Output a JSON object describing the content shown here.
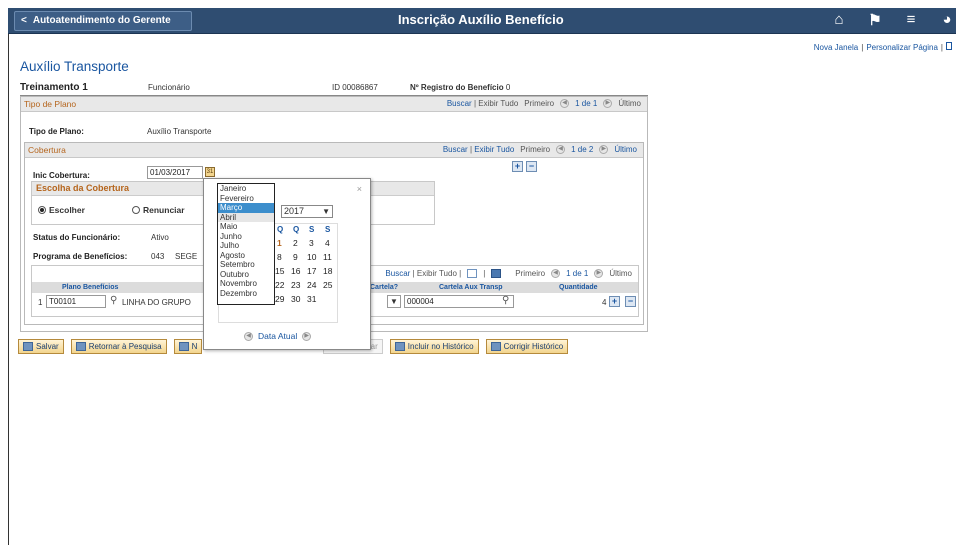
{
  "header": {
    "back_label": "Autoatendimento do Gerente",
    "page_title": "Inscrição Auxílio Benefício",
    "links": [
      "Nova Janela",
      "Personalizar Página"
    ]
  },
  "main": {
    "title": "Auxílio Transporte",
    "employee": {
      "name": "Treinamento 1",
      "role": "Funcionário",
      "id_label": "ID",
      "id_value": "00086867",
      "reg_label": "Nº Registro do Benefício",
      "reg_value": "0"
    },
    "tipo_plano": {
      "section_title": "Tipo de Plano",
      "nav": {
        "buscar": "Buscar",
        "exibir": "Exibir Tudo",
        "primeiro": "Primeiro",
        "count": "1 de 1",
        "ultimo": "Último"
      },
      "field_label": "Tipo de Plano:",
      "field_value": "Auxílio Transporte"
    },
    "cobertura": {
      "section_title": "Cobertura",
      "nav": {
        "buscar": "Buscar",
        "exibir": "Exibir Tudo",
        "primeiro": "Primeiro",
        "count": "1 de 2",
        "ultimo": "Último"
      },
      "inic_label": "Inic Cobertura:",
      "inic_value": "01/03/2017",
      "escolha_title": "Escolha da Cobertura",
      "escolher": "Escolher",
      "renunciar": "Renunciar",
      "status_label": "Status do Funcionário:",
      "status_value": "Ativo",
      "programa_label": "Programa de Benefícios:",
      "programa_code": "043",
      "programa_name": "SEGE"
    },
    "grid": {
      "nav": {
        "buscar": "Buscar",
        "exibir": "Exibir Tudo",
        "primeiro": "Primeiro",
        "count": "1 de 1",
        "ultimo": "Último"
      },
      "headers": {
        "plano": "Plano Benefícios",
        "cartela": "Cartela?",
        "cartela_aux": "Cartela Aux Transp",
        "quantidade": "Quantidade"
      },
      "row": {
        "num": "1",
        "plano": "T00101",
        "plano_desc": "LINHA DO GRUPO",
        "cartela_aux": "000004",
        "quantidade": "4"
      }
    }
  },
  "calendar": {
    "year": "2017",
    "months": [
      "Janeiro",
      "Fevereiro",
      "Março",
      "Abril",
      "Maio",
      "Junho",
      "Julho",
      "Agosto",
      "Setembro",
      "Outubro",
      "Novembro",
      "Dezembro"
    ],
    "weekday_heads": [
      "Q",
      "Q",
      "S",
      "S"
    ],
    "days": [
      [
        "1",
        "2",
        "3",
        "4"
      ],
      [
        "8",
        "9",
        "10",
        "11"
      ],
      [
        "15",
        "16",
        "17",
        "18"
      ],
      [
        "22",
        "23",
        "24",
        "25"
      ],
      [
        "29",
        "30",
        "31",
        ""
      ]
    ],
    "today_label": "Data Atual"
  },
  "toolbar": {
    "salvar": "Salvar",
    "retornar": "Retornar à Pesquisa",
    "notificar": "N",
    "atualizar": "izar/Consultar",
    "incluir": "Incluir no Histórico",
    "corrigir": "Corrigir Histórico"
  },
  "colors": {
    "header_bg": "#2f4d71",
    "link": "#1a56a0",
    "section_title": "#b5651d",
    "selected_month": "#3c8ecc"
  }
}
